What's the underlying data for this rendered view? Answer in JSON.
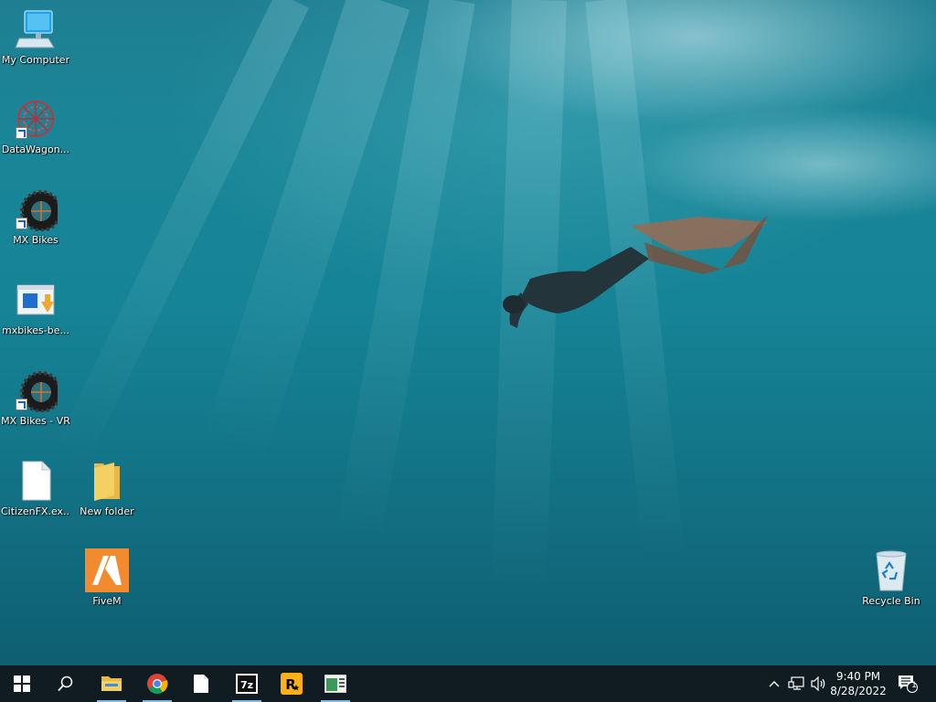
{
  "desktop_icons": [
    {
      "label": "My Computer",
      "icon": "computer-icon"
    },
    {
      "label": "DataWagon...",
      "icon": "datawagon-icon"
    },
    {
      "label": "MX Bikes",
      "icon": "tire-icon"
    },
    {
      "label": "mxbikes-be...",
      "icon": "installer-icon"
    },
    {
      "label": "MX Bikes - VR",
      "icon": "tire-icon"
    },
    {
      "label": "CitizenFX.ex...",
      "icon": "blank-file-icon"
    },
    {
      "label": "New folder",
      "icon": "folder-icon"
    },
    {
      "label": "FiveM",
      "icon": "fivem-icon"
    },
    {
      "label": "Recycle Bin",
      "icon": "recycle-bin-icon"
    }
  ],
  "taskbar": {
    "apps": [
      {
        "name": "file-explorer",
        "running": true
      },
      {
        "name": "chrome",
        "running": true
      },
      {
        "name": "notepad",
        "running": false
      },
      {
        "name": "7-zip",
        "running": true
      },
      {
        "name": "rockstar-launcher",
        "running": false
      },
      {
        "name": "app-window",
        "running": true
      }
    ],
    "clock": {
      "time": "9:40 PM",
      "date": "8/28/2022"
    },
    "notification_count": "1"
  },
  "colors": {
    "taskbar": "#101c22",
    "water": "#168497",
    "fivem": "#f28a30",
    "folder": "#f4cf62"
  }
}
